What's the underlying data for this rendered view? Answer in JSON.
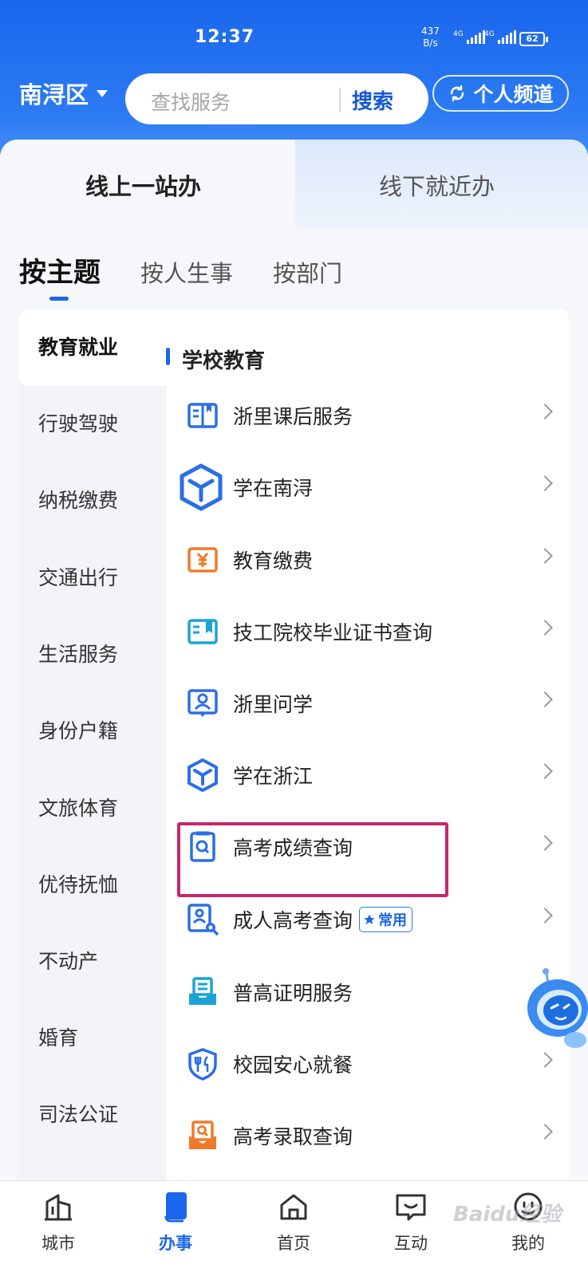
{
  "status_bar": {
    "time": "12:37",
    "net_speed_value": "437",
    "net_speed_unit": "B/s",
    "signal_1_label": "4G",
    "signal_2_label": "4G",
    "battery": "62"
  },
  "header": {
    "region": "南浔区",
    "search_placeholder": "查找服务",
    "search_button": "搜索",
    "personal_channel": "个人频道"
  },
  "segments": {
    "online": "线上一站办",
    "offline": "线下就近办"
  },
  "category_tabs": [
    "按主题",
    "按人生事",
    "按部门"
  ],
  "sidebar": {
    "items": [
      "教育就业",
      "行驶驾驶",
      "纳税缴费",
      "交通出行",
      "生活服务",
      "身份户籍",
      "文旅体育",
      "优待抚恤",
      "不动产",
      "婚育",
      "司法公证"
    ]
  },
  "section": {
    "title": "学校教育",
    "items": [
      {
        "label": "浙里课后服务",
        "icon": "open-book-icon",
        "color": "#2a6ee8"
      },
      {
        "label": "学在南浔",
        "icon": "cube-icon",
        "color": "#2a6ee8"
      },
      {
        "label": "教育缴费",
        "icon": "yuan-book-icon",
        "color": "#f07a2a"
      },
      {
        "label": "技工院校毕业证书查询",
        "icon": "certificate-book-icon",
        "color": "#1aa3d8"
      },
      {
        "label": "浙里问学",
        "icon": "person-board-icon",
        "color": "#2a6ee8"
      },
      {
        "label": "学在浙江",
        "icon": "cube-icon",
        "color": "#2a6ee8"
      },
      {
        "label": "高考成绩查询",
        "icon": "search-doc-icon",
        "color": "#2a6ee8"
      },
      {
        "label": "成人高考查询",
        "icon": "person-search-icon",
        "color": "#2a6ee8",
        "badge": "常用"
      },
      {
        "label": "普高证明服务",
        "icon": "tray-doc-icon",
        "color": "#1aa3d8"
      },
      {
        "label": "校园安心就餐",
        "icon": "shield-fork-icon",
        "color": "#2a6ee8"
      },
      {
        "label": "高考录取查询",
        "icon": "envelope-search-icon",
        "color": "#f07a2a"
      }
    ]
  },
  "bottom_nav": [
    "城市",
    "办事",
    "首页",
    "互动",
    "我的"
  ],
  "colors": {
    "primary": "#1a66ec",
    "highlight_box": "#c5286a"
  },
  "watermark": "Baidu经验"
}
